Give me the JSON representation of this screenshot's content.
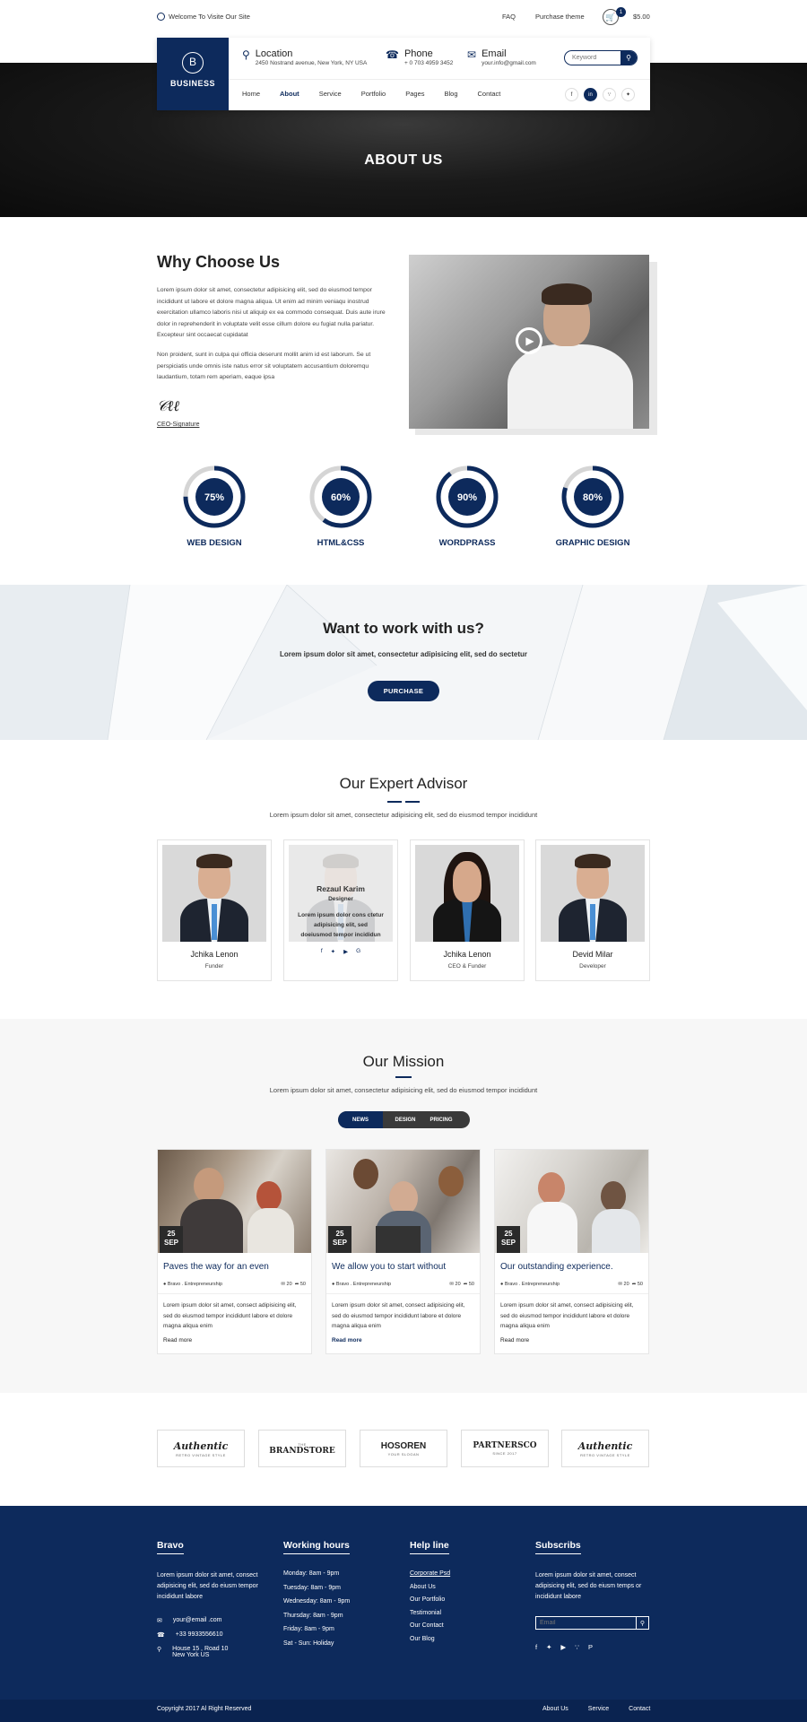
{
  "topbar": {
    "welcome": "Welcome To Visite Our Site",
    "faq": "FAQ",
    "purchase_theme": "Purchase theme",
    "cart_count": "1",
    "price": "$5.00"
  },
  "logo": {
    "letter": "B",
    "text": "BUSINESS"
  },
  "header": {
    "location_title": "Location",
    "location_text": "2450 Nostrand avenue, New York, NY USA",
    "phone_title": "Phone",
    "phone_text": "+ 0 703 4959 3452",
    "email_title": "Email",
    "email_text": "your.info@gmail.com",
    "search_placeholder": "Keyword"
  },
  "nav": [
    "Home",
    "About",
    "Service",
    "Portfolio",
    "Pages",
    "Blog",
    "Contact"
  ],
  "nav_active": "About",
  "social_top": [
    "f",
    "in",
    "rss",
    "tw"
  ],
  "hero": {
    "title": "ABOUT US"
  },
  "why": {
    "title": "Why Choose Us",
    "p1": "Lorem ipsum dolor sit amet, consectetur adipisicing elit, sed do eiusmod tempor incididunt ut labore et dolore magna aliqua. Ut enim ad minim veniaqu inostrud exercitation ullamco laboris nisi ut aliquip ex ea commodo consequat. Duis aute irure dolor in reprehenderit in voluptate velit esse cillum dolore eu fugiat nulla pariatur. Excepteur sint occaecat cupidatat",
    "p2": "Non proident, sunt in culpa qui officia deserunt mollit anim id est laborum. Se ut perspiciatis unde omnis iste natus error sit voluptatem accusantium doloremqu laudantium, totam rem aperiam, eaque ipsa",
    "signature_label": "CEO-Signature"
  },
  "skills": [
    {
      "label": "WEB DESIGN",
      "percent": 75,
      "text": "75%"
    },
    {
      "label": "HTML&CSS",
      "percent": 60,
      "text": "60%"
    },
    {
      "label": "WORDPRASS",
      "percent": 90,
      "text": "90%"
    },
    {
      "label": "GRAPHIC DESIGN",
      "percent": 80,
      "text": "80%"
    }
  ],
  "work": {
    "title": "Want to work with us?",
    "subtitle": "Lorem ipsum dolor sit amet, consectetur adipisicing elit, sed do sectetur",
    "button": "PURCHASE"
  },
  "advisor": {
    "title": "Our Expert Advisor",
    "subtitle": "Lorem ipsum dolor sit amet, consectetur adipisicing elit, sed do eiusmod tempor incididunt",
    "members": [
      {
        "name": "Jchika Lenon",
        "role": "Funder"
      },
      {
        "name": "Rezaul Karim",
        "role": "Designer",
        "desc": "Lorem ipsum dolor cons ctetur adipisicing elit, sed doeiusmod tempor incididun"
      },
      {
        "name": "Jchika Lenon",
        "role": "CEO & Funder"
      },
      {
        "name": "Devid Milar",
        "role": "Developer"
      }
    ],
    "social": [
      "f",
      "t",
      "yt",
      "G"
    ]
  },
  "mission": {
    "title": "Our Mission",
    "subtitle": "Lorem ipsum dolor sit amet, consectetur adipisicing elit, sed do eiusmod tempor incididunt",
    "tabs": [
      "NEWS",
      "DESIGN",
      "PRICING"
    ],
    "posts": [
      {
        "day": "25",
        "month": "SEP",
        "title": "Paves the way for an even",
        "meta": "Bravo . Entrepreneurship",
        "comments": "20",
        "shares": "50",
        "desc": "Lorem ipsum dolor sit amet, consect adipisicing elit, sed do eiusmod tempor incididunt labore et dolore magna aliqua enim",
        "more": "Read more"
      },
      {
        "day": "25",
        "month": "SEP",
        "title": "We allow you to start without",
        "meta": "Bravo . Entrepreneurship",
        "comments": "20",
        "shares": "50",
        "desc": "Lorem ipsum dolor sit amet, consect adipisicing elit, sed do eiusmod tempor incididunt labore et dolore magna aliqua enim",
        "more": "Read more"
      },
      {
        "day": "25",
        "month": "SEP",
        "title": "Our outstanding experience.",
        "meta": "Bravo . Entrepreneurship",
        "comments": "20",
        "shares": "50",
        "desc": "Lorem ipsum dolor sit amet, consect adipisicing elit, sed do eiusmod tempor incididunt labore et dolore magna aliqua enim",
        "more": "Read more"
      }
    ]
  },
  "brands": [
    {
      "name": "Authentic",
      "sub": "RETRO VINTAGE STYLE"
    },
    {
      "name": "BRANDSTORE",
      "sub": "THE"
    },
    {
      "name": "HOSOREN",
      "sub": "YOUR SLOGAN"
    },
    {
      "name": "PARTNERSCO",
      "sub": "SINCE 2017"
    },
    {
      "name": "Authentic",
      "sub": "RETRO VINTAGE STYLE"
    }
  ],
  "footer": {
    "col1_title": "Bravo",
    "col1_text": "Lorem ipsum dolor sit amet, consect adipisicing elit, sed do eiusm tempor incididunt labore",
    "email": "your@email .com",
    "phone": "+33 9933556610",
    "address1": "House 15 , Road 10",
    "address2": "New York US",
    "col2_title": "Working hours",
    "hours": [
      "Monday:  8am - 9pm",
      "Tuesday:  8am - 9pm",
      "Wednesday:  8am - 9pm",
      "Thursday:  8am - 9pm",
      "Friday:  8am - 9pm",
      "Sat - Sun: Holiday"
    ],
    "col3_title": "Help line",
    "links": [
      "Corporate Psd",
      "About Us",
      "Our Portfolio",
      "Testimonial",
      "Our Contact",
      "Our Blog"
    ],
    "col4_title": "Subscribs",
    "col4_text": "Lorem ipsum dolor sit amet, consect adipisicing elit, sed do eiusm temps or incididunt labore",
    "email_placeholder": "Email",
    "copyright": "Copyright 2017 Al Right Reserved",
    "bottom_nav": [
      "About Us",
      "Service",
      "Contact"
    ]
  }
}
